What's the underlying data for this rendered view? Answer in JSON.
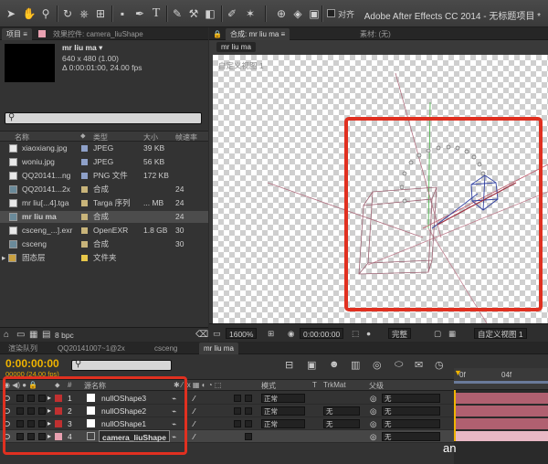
{
  "app": {
    "title": "Adobe After Effects CC 2014 - 无标题项目 *"
  },
  "toolbar": {
    "align_label": "对齐"
  },
  "project_panel": {
    "tabs": [
      "项目 ≡",
      "效果控件: camera_liuShape"
    ],
    "comp_name": "mr liu ma ▾",
    "comp_dims": "640 x 480 (1.00)",
    "comp_duration": "Δ 0:00:01:00, 24.00 fps",
    "search_icon": "magnifier-icon",
    "columns": [
      "名称",
      "类型",
      "大小",
      "帧速率"
    ],
    "items": [
      {
        "name": "xiaoxiang.jpg",
        "type": "JPEG",
        "size": "39 KB",
        "fps": "",
        "swatch": "#8ea0c8",
        "kind": "file"
      },
      {
        "name": "woniu.jpg",
        "type": "JPEG",
        "size": "56 KB",
        "fps": "",
        "swatch": "#8ea0c8",
        "kind": "file"
      },
      {
        "name": "QQ20141...ng",
        "type": "PNG 文件",
        "size": "172 KB",
        "fps": "",
        "swatch": "#8ea0c8",
        "kind": "file"
      },
      {
        "name": "QQ20141...2x",
        "type": "合成",
        "size": "",
        "fps": "24",
        "swatch": "#c8b47a",
        "kind": "comp"
      },
      {
        "name": "mr liu[...4].tga",
        "type": "Targa 序列",
        "size": "... MB",
        "fps": "24",
        "swatch": "#c8b47a",
        "kind": "file"
      },
      {
        "name": "mr liu ma",
        "type": "合成",
        "size": "",
        "fps": "24",
        "swatch": "#c8b47a",
        "kind": "comp"
      },
      {
        "name": "csceng_...].exr",
        "type": "OpenEXR",
        "size": "1.8 GB",
        "fps": "30",
        "swatch": "#c8b47a",
        "kind": "file"
      },
      {
        "name": "csceng",
        "type": "合成",
        "size": "",
        "fps": "30",
        "swatch": "#c8b47a",
        "kind": "comp"
      },
      {
        "name": "固态层",
        "type": "文件夹",
        "size": "",
        "fps": "",
        "swatch": "#e8c84a",
        "kind": "folder"
      }
    ],
    "bpc": "8 bpc"
  },
  "comp_panel": {
    "tabs": [
      "合成: mr liu ma ≡",
      "素材: (无)"
    ],
    "comp_tab": "mr liu ma",
    "view_label": "自定义视图 1",
    "zoom": "1600%",
    "timecode": "0:00:00:00",
    "quality": "完整",
    "view": "自定义视图 1"
  },
  "timeline": {
    "tabs": [
      "渲染队列",
      "QQ20141007~1@2x",
      "csceng",
      "mr liu ma"
    ],
    "timecode": "0:00:00:00",
    "fps_sub": "00000 (24.00 fps)",
    "columns": {
      "source": "源名称",
      "mode": "模式",
      "t": "T",
      "trkmat": "TrkMat",
      "parent": "父级"
    },
    "ruler": [
      "0f",
      "04f"
    ],
    "layers": [
      {
        "num": "1",
        "name": "nullOShape3",
        "mode": "正常",
        "trkmat": "",
        "parent": "无",
        "color": "#c03030"
      },
      {
        "num": "2",
        "name": "nullOShape2",
        "mode": "正常",
        "trkmat": "无",
        "parent": "无",
        "color": "#c03030"
      },
      {
        "num": "3",
        "name": "nullOShape1",
        "mode": "正常",
        "trkmat": "无",
        "parent": "无",
        "color": "#c03030"
      },
      {
        "num": "4",
        "name": "camera_liuShape",
        "mode": "",
        "trkmat": "",
        "parent": "无",
        "color": "#e8a0b0"
      }
    ],
    "track_fragment": "an"
  }
}
